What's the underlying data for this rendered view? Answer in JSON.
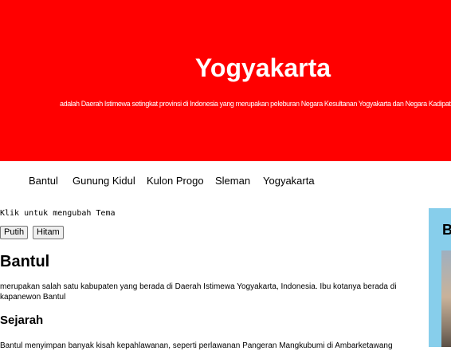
{
  "header": {
    "title": "Yogyakarta",
    "description": "adalah Daerah Istimewa setingkat provinsi di Indonesia yang merupakan peleburan Negara Kesultanan Yogyakarta dan Negara Kadipaten Pakualaman."
  },
  "nav": {
    "items": [
      "Bantul",
      "Gunung Kidul",
      "Kulon Progo",
      "Sleman",
      "Yogyakarta"
    ]
  },
  "theme": {
    "label": "Klik untuk mengubah Tema",
    "buttons": [
      "Putih",
      "Hitam"
    ]
  },
  "main": {
    "title": "Bantul",
    "text": "merupakan salah satu kabupaten yang berada di Daerah Istimewa Yogyakarta, Indonesia. Ibu kotanya berada di kapanewon Bantul",
    "section_title": "Sejarah",
    "section_text": "Bantul menyimpan banyak kisah kepahlawanan, seperti perlawanan Pangeran Mangkubumi di Ambarketawang"
  },
  "aside": {
    "title": "B"
  },
  "colors": {
    "header_bg": "#ff0000",
    "aside_bg": "#87ceeb"
  }
}
